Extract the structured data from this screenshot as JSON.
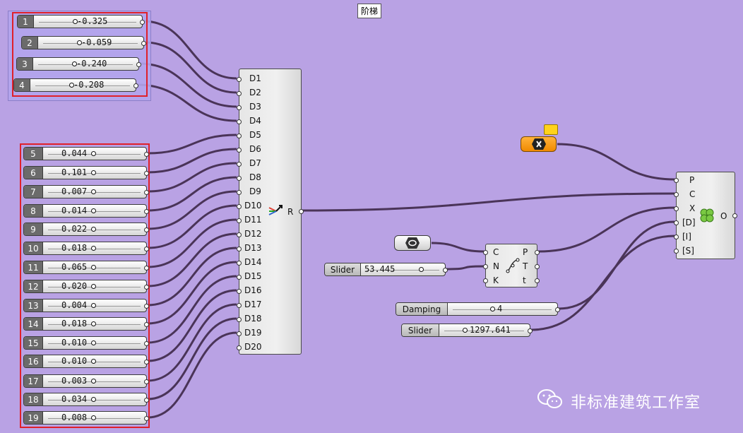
{
  "scribble": "阶梯",
  "group_sliders": [
    {
      "index": "1",
      "value": "-0.325"
    },
    {
      "index": "2",
      "value": "-0.059"
    },
    {
      "index": "3",
      "value": "-0.240"
    },
    {
      "index": "4",
      "value": "-0.208"
    }
  ],
  "sliders": [
    {
      "index": "5",
      "value": "0.044"
    },
    {
      "index": "6",
      "value": "0.101"
    },
    {
      "index": "7",
      "value": "0.007"
    },
    {
      "index": "8",
      "value": "0.014"
    },
    {
      "index": "9",
      "value": "0.022"
    },
    {
      "index": "10",
      "value": "0.018"
    },
    {
      "index": "11",
      "value": "0.065"
    },
    {
      "index": "12",
      "value": "0.020"
    },
    {
      "index": "13",
      "value": "0.004"
    },
    {
      "index": "14",
      "value": "0.018"
    },
    {
      "index": "15",
      "value": "0.010"
    },
    {
      "index": "16",
      "value": "0.010"
    },
    {
      "index": "17",
      "value": "0.003"
    },
    {
      "index": "18",
      "value": "0.034"
    },
    {
      "index": "19",
      "value": "0.008"
    }
  ],
  "merge": {
    "inputs": [
      "D1",
      "D2",
      "D3",
      "D4",
      "D5",
      "D6",
      "D7",
      "D8",
      "D9",
      "D10",
      "D11",
      "D12",
      "D13",
      "D14",
      "D15",
      "D16",
      "D17",
      "D18",
      "D19",
      "D20"
    ],
    "output": "R"
  },
  "sub_curve": {
    "inputs": [
      "C",
      "N",
      "K"
    ],
    "outputs": [
      "P",
      "T",
      "t"
    ]
  },
  "solver": {
    "inputs": [
      "P",
      "C",
      "X",
      "[D]",
      "[I]",
      "[S]"
    ],
    "output": "O"
  },
  "n_slider": {
    "label": "Slider",
    "value": "53.445"
  },
  "damping_slider": {
    "label": "Damping",
    "value": "4"
  },
  "big_slider": {
    "label": "Slider",
    "value": "1297.641"
  },
  "watermark": "非标准建筑工作室"
}
